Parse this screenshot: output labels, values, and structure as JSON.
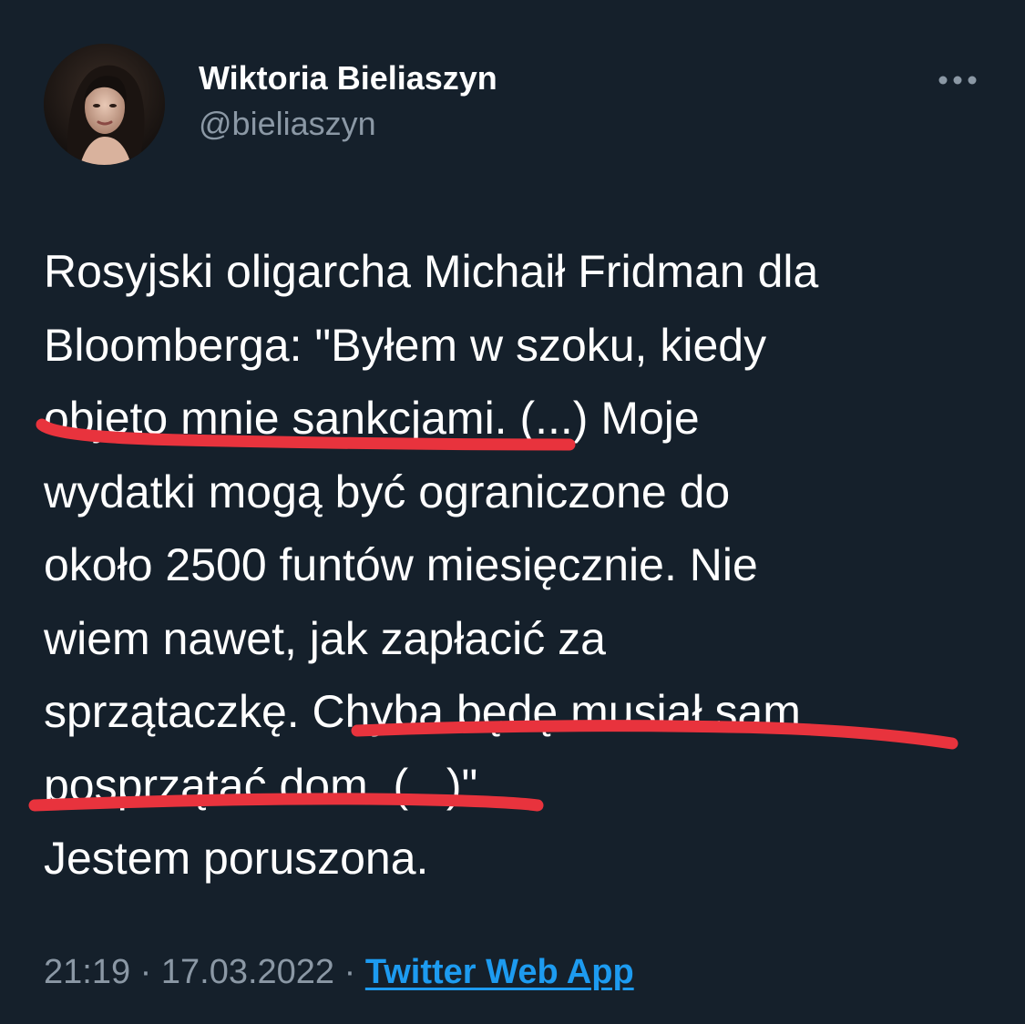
{
  "author": {
    "display_name": "Wiktoria Bieliaszyn",
    "handle": "@bieliaszyn",
    "avatar_icon": "profile-photo"
  },
  "menu": {
    "icon": "more-horizontal-icon",
    "glyph": "•••"
  },
  "tweet": {
    "text": "Rosyjski oligarcha Michaił Fridman dla\nBloomberga: \"Byłem w szoku, kiedy\nobjęto mnie sankcjami. (...) Moje\nwydatki mogą być ograniczone do\nokoło 2500 funtów miesięcznie. Nie\nwiem nawet, jak zapłacić za\nsprzątaczkę. Chyba będę musiał sam\nposprzątać dom. (...)\".\nJestem poruszona.",
    "time": "21:19",
    "separator": "·",
    "date": "17.03.2022",
    "source": "Twitter Web App"
  },
  "annotations": {
    "underline_color": "#e8333d"
  },
  "theme": {
    "background": "#15202b",
    "text": "#ffffff",
    "muted": "#8b98a5",
    "link": "#1d9bf0"
  }
}
